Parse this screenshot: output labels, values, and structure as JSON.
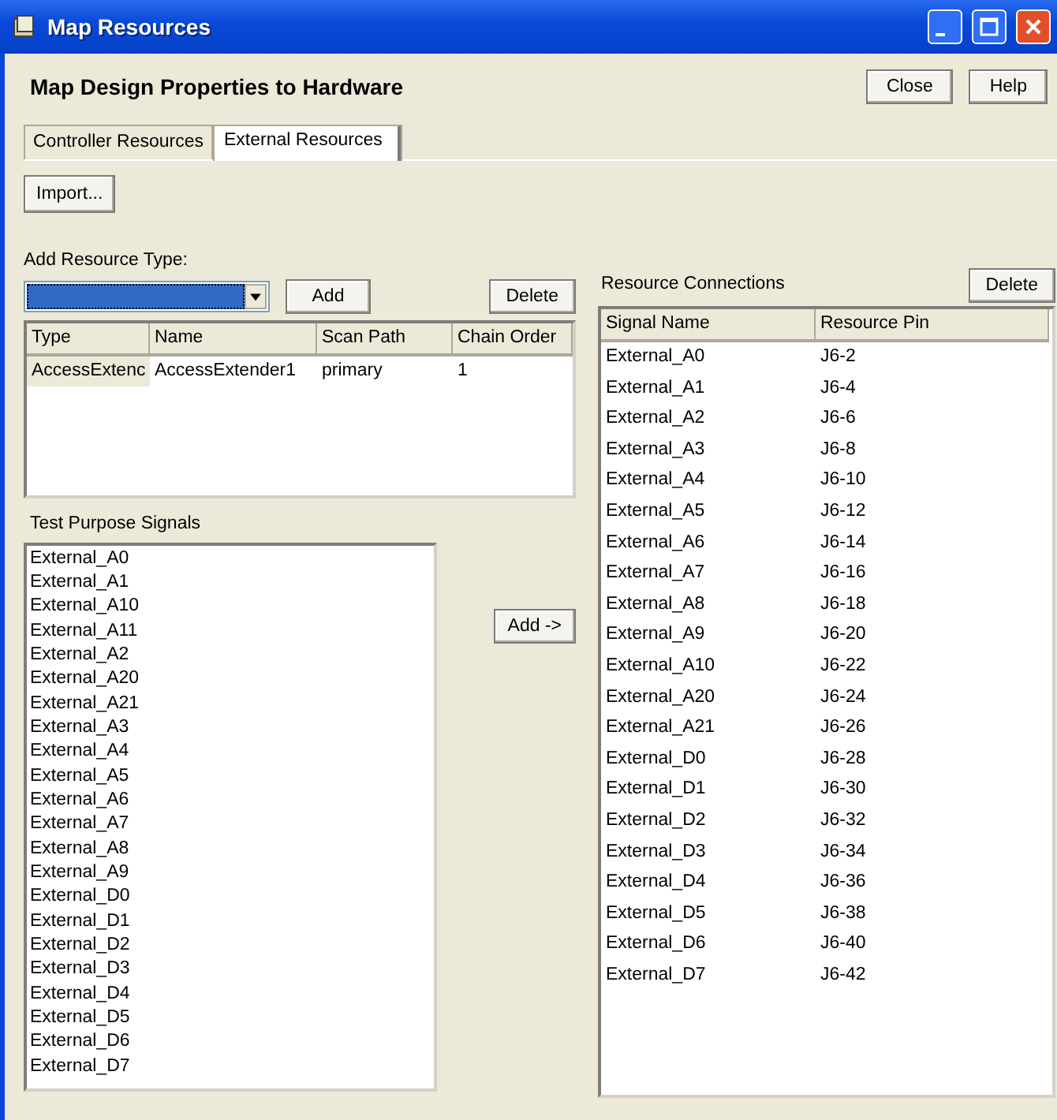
{
  "window": {
    "title": "Map Resources"
  },
  "header": {
    "title": "Map Design Properties to Hardware",
    "buttons": [
      "Close",
      "Help"
    ]
  },
  "tabs": [
    {
      "label": "Controller Resources",
      "selected": false
    },
    {
      "label": "External Resources",
      "selected": true
    }
  ],
  "import_button": "Import...",
  "add_resource": {
    "label": "Add Resource Type:",
    "combo": {
      "focused": true
    },
    "add_button": "Add",
    "delete_button": "Delete"
  },
  "resources_table": {
    "columns": [
      "Type",
      "Name",
      "Scan Path",
      "Chain Order"
    ],
    "rows": [
      {
        "cells": [
          "AccessExtenc",
          "AccessExtender1",
          "primary",
          "1"
        ],
        "selected": true
      }
    ]
  },
  "test_purpose_signals": {
    "label": "Test Purpose Signals",
    "items": [
      "External_A0",
      "External_A1",
      "External_A10",
      "External_A11",
      "External_A2",
      "External_A20",
      "External_A21",
      "External_A3",
      "External_A4",
      "External_A5",
      "External_A6",
      "External_A7",
      "External_A8",
      "External_A9",
      "External_D0",
      "External_D1",
      "External_D2",
      "External_D3",
      "External_D4",
      "External_D5",
      "External_D6",
      "External_D7"
    ],
    "add_button": "Add ->"
  },
  "resource_connections": {
    "label": "Resource Connections",
    "delete_button": "Delete",
    "columns": [
      "Signal Name",
      "Resource Pin"
    ],
    "rows": [
      [
        "External_A0",
        "J6-2"
      ],
      [
        "External_A1",
        "J6-4"
      ],
      [
        "External_A2",
        "J6-6"
      ],
      [
        "External_A3",
        "J6-8"
      ],
      [
        "External_A4",
        "J6-10"
      ],
      [
        "External_A5",
        "J6-12"
      ],
      [
        "External_A6",
        "J6-14"
      ],
      [
        "External_A7",
        "J6-16"
      ],
      [
        "External_A8",
        "J6-18"
      ],
      [
        "External_A9",
        "J6-20"
      ],
      [
        "External_A10",
        "J6-22"
      ],
      [
        "External_A20",
        "J6-24"
      ],
      [
        "External_A21",
        "J6-26"
      ],
      [
        "External_D0",
        "J6-28"
      ],
      [
        "External_D1",
        "J6-30"
      ],
      [
        "External_D2",
        "J6-32"
      ],
      [
        "External_D3",
        "J6-34"
      ],
      [
        "External_D4",
        "J6-36"
      ],
      [
        "External_D5",
        "J6-38"
      ],
      [
        "External_D6",
        "J6-40"
      ],
      [
        "External_D7",
        "J6-42"
      ]
    ]
  }
}
